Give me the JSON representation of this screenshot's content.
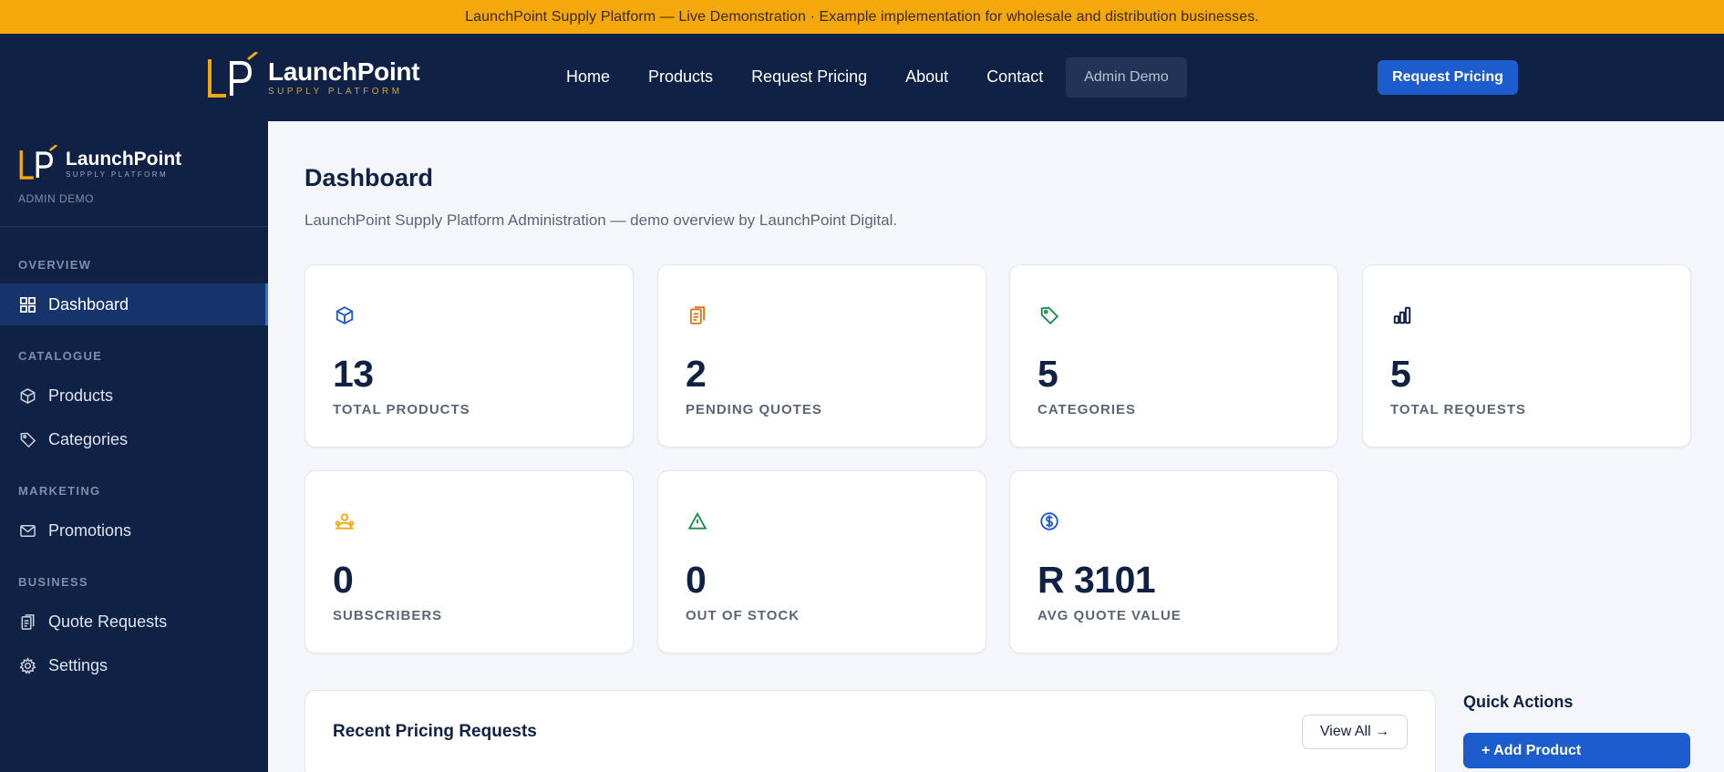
{
  "banner": {
    "text": "LaunchPoint Supply Platform — Live Demonstration · Example implementation for wholesale and distribution businesses."
  },
  "header": {
    "logo": {
      "name": "LaunchPoint",
      "tagline": "SUPPLY PLATFORM"
    },
    "nav": [
      "Home",
      "Products",
      "Request Pricing",
      "About",
      "Contact",
      "Admin Demo"
    ],
    "cta": "Request Pricing"
  },
  "sidebar": {
    "brand": {
      "name": "LaunchPoint",
      "tagline": "SUPPLY PLATFORM"
    },
    "role": "ADMIN DEMO",
    "sections": [
      "OVERVIEW",
      "CATALOGUE",
      "MARKETING",
      "BUSINESS"
    ],
    "items": [
      {
        "label": "Dashboard",
        "icon": "grid-icon",
        "active": true
      },
      {
        "label": "Products",
        "icon": "box-icon"
      },
      {
        "label": "Categories",
        "icon": "tag-icon"
      },
      {
        "label": "Promotions",
        "icon": "mail-icon"
      },
      {
        "label": "Quote Requests",
        "icon": "clipboard-icon"
      },
      {
        "label": "Settings",
        "icon": "gear-icon"
      }
    ]
  },
  "main": {
    "title": "Dashboard",
    "subtitle": "LaunchPoint Supply Platform Administration — demo overview by LaunchPoint Digital.",
    "stats": [
      {
        "value": "13",
        "label": "TOTAL PRODUCTS",
        "icon": "box-icon",
        "color": "#1d5ccd"
      },
      {
        "value": "2",
        "label": "PENDING QUOTES",
        "icon": "clipboard-icon",
        "color": "#e0731b"
      },
      {
        "value": "5",
        "label": "CATEGORIES",
        "icon": "tag-icon",
        "color": "#1e8a4a"
      },
      {
        "value": "5",
        "label": "TOTAL REQUESTS",
        "icon": "bar-chart-icon",
        "color": "#0f2144"
      },
      {
        "value": "0",
        "label": "SUBSCRIBERS",
        "icon": "users-icon",
        "color": "#f4a80b"
      },
      {
        "value": "0",
        "label": "OUT OF STOCK",
        "icon": "warning-icon",
        "color": "#1e8a4a"
      },
      {
        "value": "R 3101",
        "label": "AVG QUOTE VALUE",
        "icon": "dollar-icon",
        "color": "#1d5ccd"
      }
    ],
    "recent": {
      "title": "Recent Pricing Requests",
      "view_all": "View All →"
    },
    "quick_actions": {
      "title": "Quick Actions",
      "add_product": "+ Add Product"
    }
  }
}
